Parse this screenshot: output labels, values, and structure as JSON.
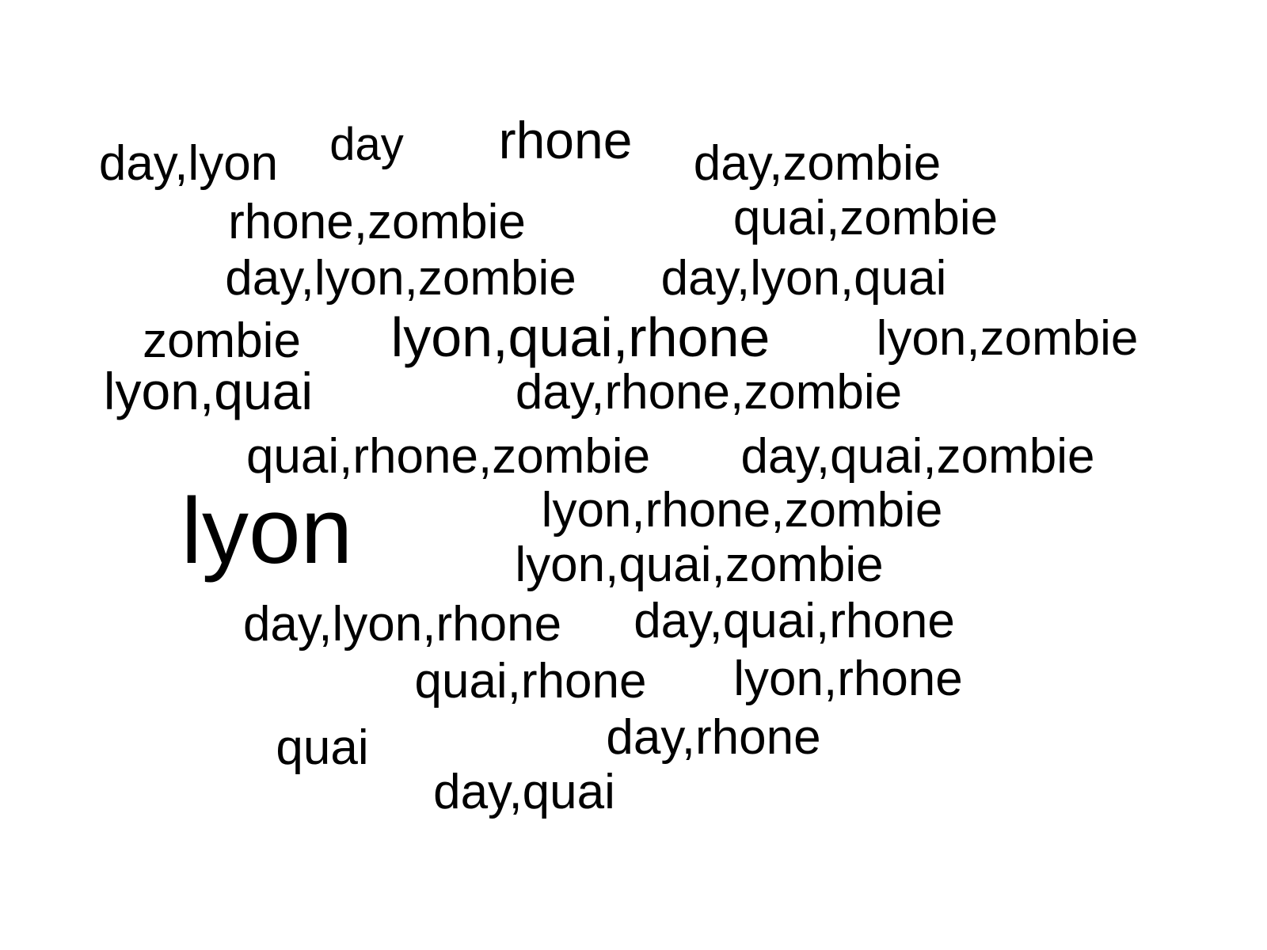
{
  "words": [
    {
      "id": "day-lyon",
      "text": "day,lyon"
    },
    {
      "id": "day",
      "text": "day"
    },
    {
      "id": "rhone",
      "text": "rhone"
    },
    {
      "id": "day-zombie",
      "text": "day,zombie"
    },
    {
      "id": "rhone-zombie",
      "text": "rhone,zombie"
    },
    {
      "id": "quai-zombie",
      "text": "quai,zombie"
    },
    {
      "id": "day-lyon-zombie",
      "text": "day,lyon,zombie"
    },
    {
      "id": "day-lyon-quai",
      "text": "day,lyon,quai"
    },
    {
      "id": "zombie",
      "text": "zombie"
    },
    {
      "id": "lyon-quai-rhone",
      "text": "lyon,quai,rhone"
    },
    {
      "id": "lyon-zombie",
      "text": "lyon,zombie"
    },
    {
      "id": "lyon-quai",
      "text": "lyon,quai"
    },
    {
      "id": "day-rhone-zombie",
      "text": "day,rhone,zombie"
    },
    {
      "id": "quai-rhone-zombie",
      "text": "quai,rhone,zombie"
    },
    {
      "id": "day-quai-zombie",
      "text": "day,quai,zombie"
    },
    {
      "id": "lyon",
      "text": "lyon"
    },
    {
      "id": "lyon-rhone-zombie",
      "text": "lyon,rhone,zombie"
    },
    {
      "id": "lyon-quai-zombie",
      "text": "lyon,quai,zombie"
    },
    {
      "id": "day-lyon-rhone",
      "text": "day,lyon,rhone"
    },
    {
      "id": "day-quai-rhone",
      "text": "day,quai,rhone"
    },
    {
      "id": "quai-rhone",
      "text": "quai,rhone"
    },
    {
      "id": "lyon-rhone",
      "text": "lyon,rhone"
    },
    {
      "id": "quai",
      "text": "quai"
    },
    {
      "id": "day-rhone",
      "text": "day,rhone"
    },
    {
      "id": "day-quai",
      "text": "day,quai"
    }
  ],
  "colors": {
    "background": "#ffffff",
    "text": "#000000"
  }
}
